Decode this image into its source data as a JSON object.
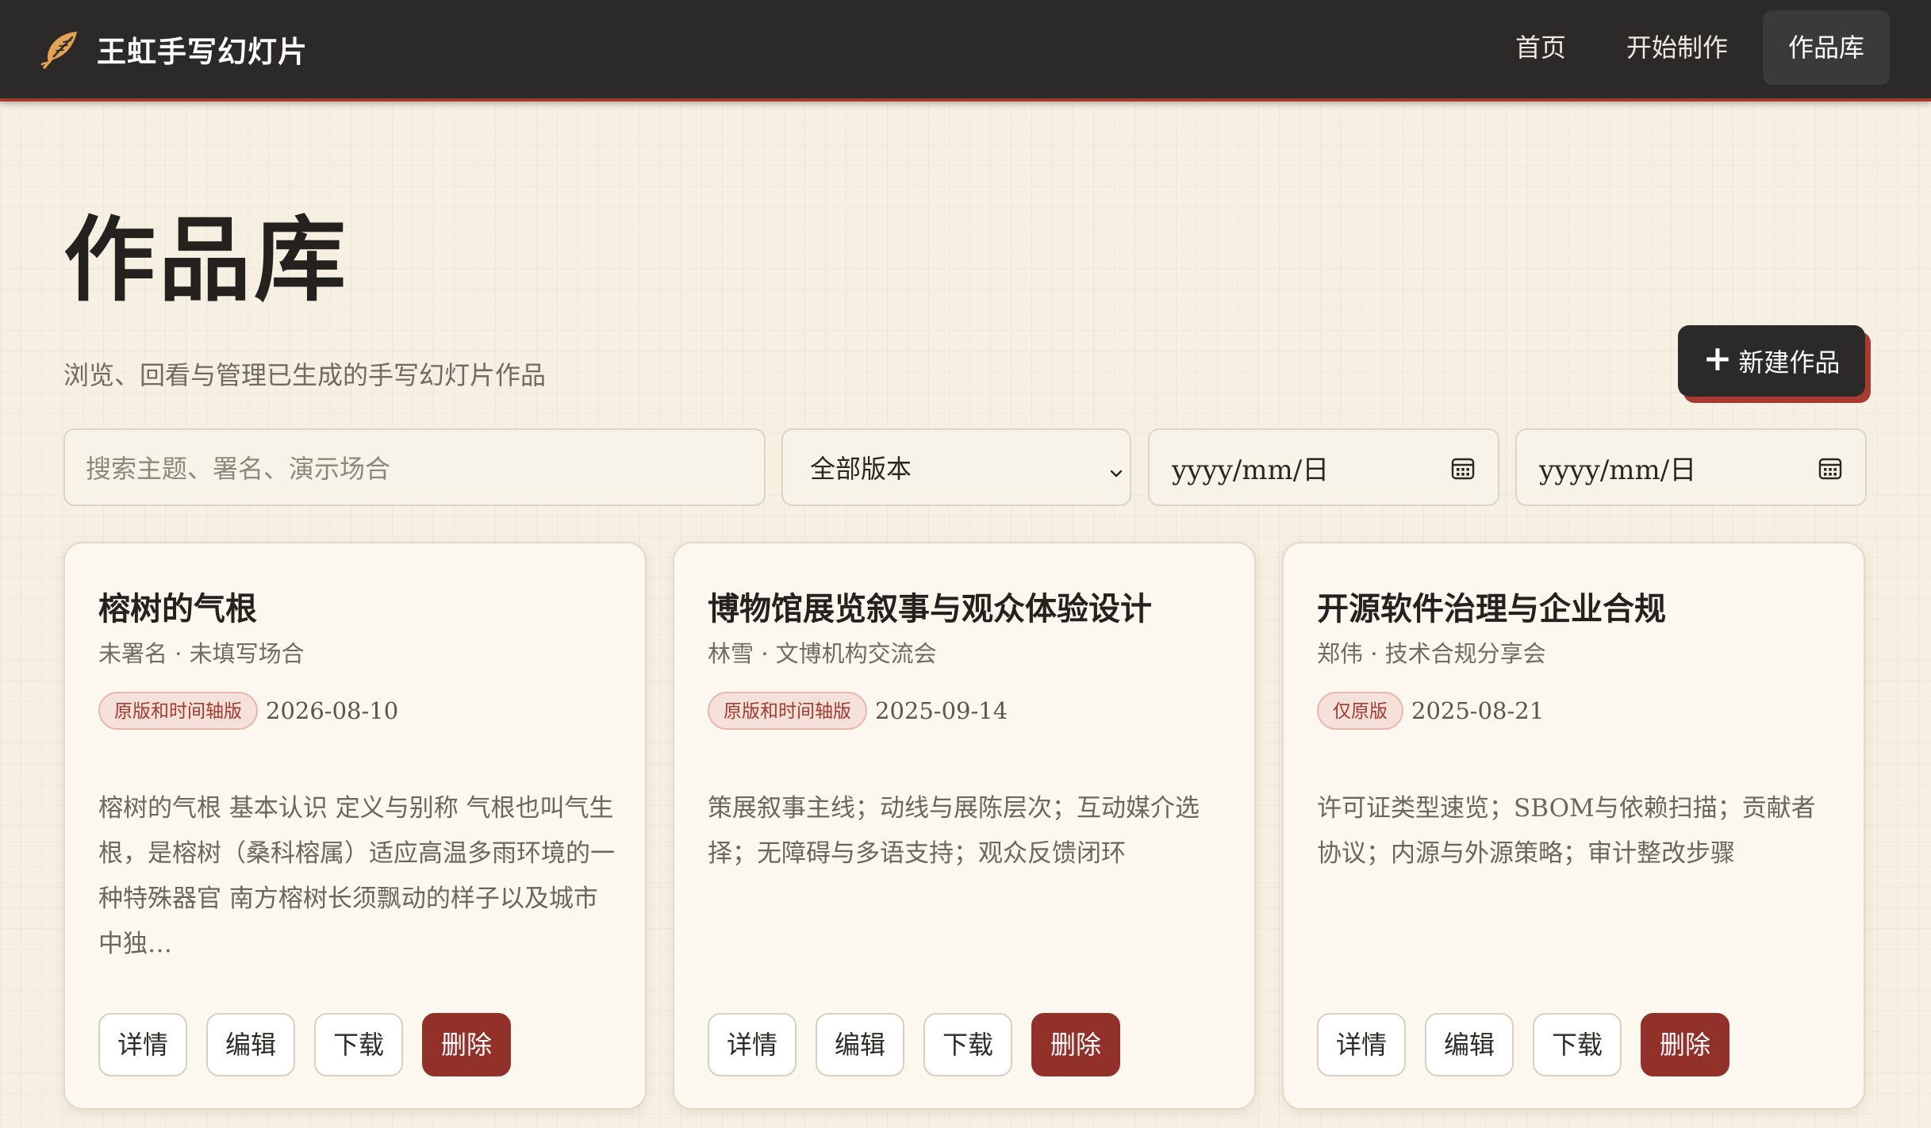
{
  "app": {
    "name": "王虹手写幻灯片",
    "logo_icon": "feather-icon",
    "accent_color": "#a53a30",
    "nav": [
      {
        "label": "首页"
      },
      {
        "label": "开始制作"
      },
      {
        "label": "作品库",
        "active": true
      }
    ]
  },
  "page": {
    "title": "作品库",
    "subtitle": "浏览、回看与管理已生成的手写幻灯片作品",
    "new_button": {
      "icon": "+",
      "label": "新建作品"
    }
  },
  "filters": {
    "search_placeholder": "搜索主题、署名、演示场合",
    "version_select": {
      "selected": "全部版本",
      "icon": "chevron-down-icon"
    },
    "date_from_placeholder": "yyyy/mm/日",
    "date_to_placeholder": "yyyy/mm/日",
    "date_icon": "calendar-icon"
  },
  "cards": [
    {
      "title": "榕树的气根",
      "meta": "未署名 · 未填写场合",
      "badge": "原版和时间轴版",
      "date": "2026-08-10",
      "description": "榕树的气根 基本认识 定义与别称 气根也叫气生根，是榕树（桑科榕属）适应高温多雨环境的一种特殊器官 南方榕树长须飘动的样子以及城市中独…",
      "actions": {
        "details": "详情",
        "edit": "编辑",
        "download": "下载",
        "delete": "删除"
      }
    },
    {
      "title": "博物馆展览叙事与观众体验设计",
      "meta": "林雪 · 文博机构交流会",
      "badge": "原版和时间轴版",
      "date": "2025-09-14",
      "description": "策展叙事主线；动线与展陈层次；互动媒介选择；无障碍与多语支持；观众反馈闭环",
      "actions": {
        "details": "详情",
        "edit": "编辑",
        "download": "下载",
        "delete": "删除"
      }
    },
    {
      "title": "开源软件治理与企业合规",
      "meta": "郑伟 · 技术合规分享会",
      "badge": "仅原版",
      "date": "2025-08-21",
      "description": "许可证类型速览；SBOM与依赖扫描；贡献者协议；内源与外源策略；审计整改步骤",
      "actions": {
        "details": "详情",
        "edit": "编辑",
        "download": "下载",
        "delete": "删除"
      }
    }
  ]
}
